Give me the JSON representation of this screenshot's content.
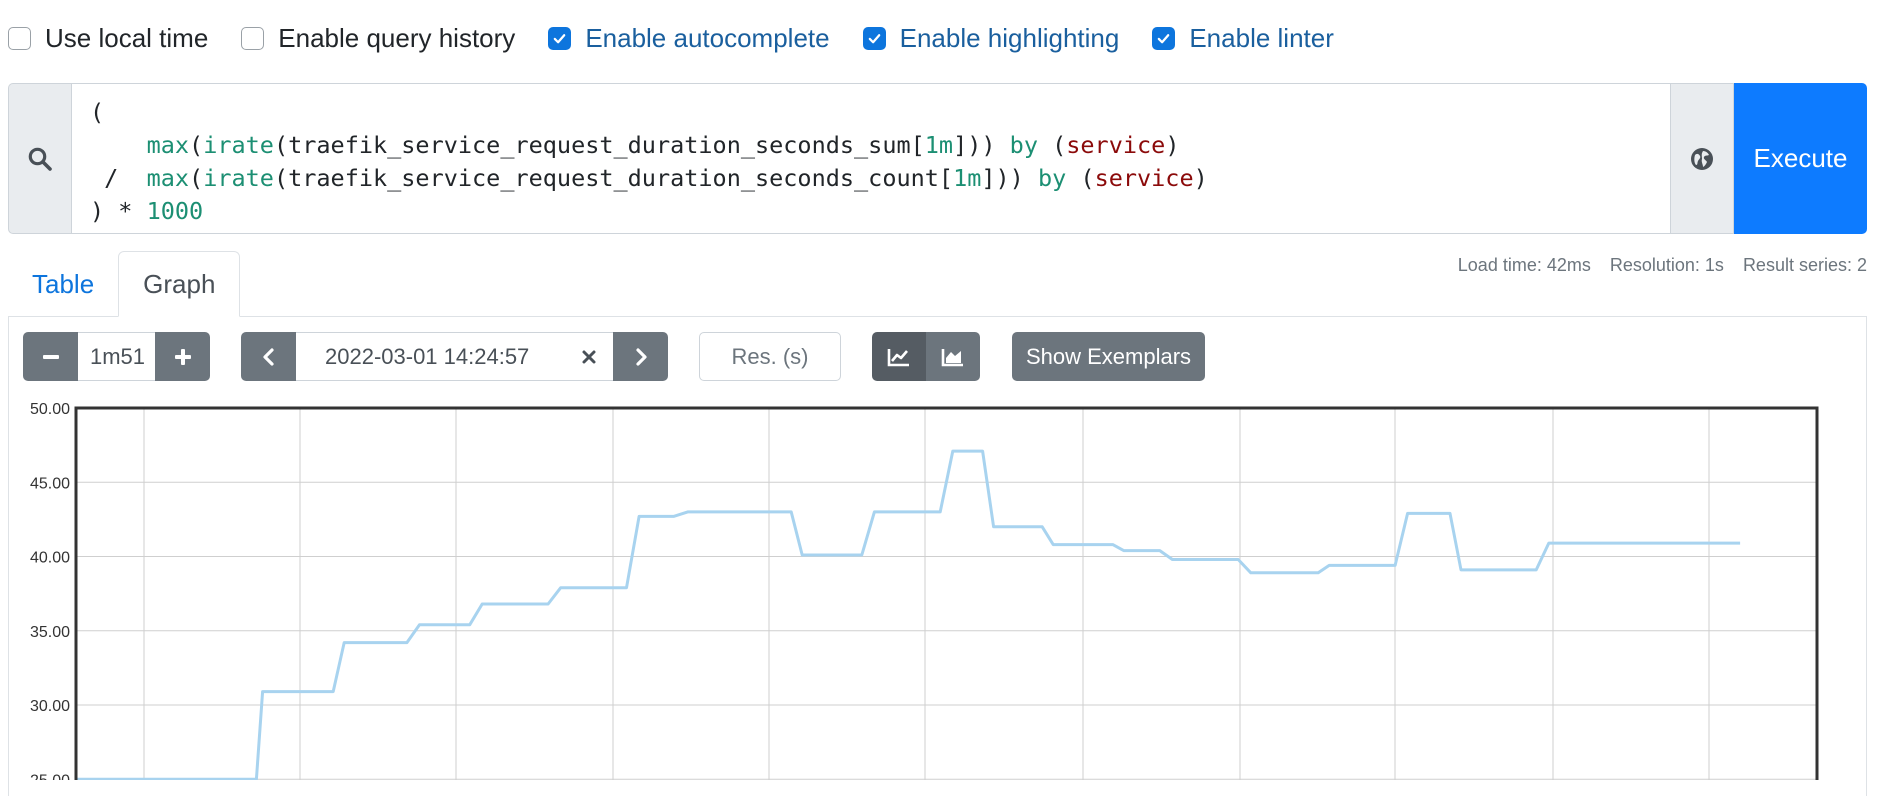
{
  "options": [
    {
      "label": "Use local time",
      "checked": false
    },
    {
      "label": "Enable query history",
      "checked": false
    },
    {
      "label": "Enable autocomplete",
      "checked": true
    },
    {
      "label": "Enable highlighting",
      "checked": true
    },
    {
      "label": "Enable linter",
      "checked": true
    }
  ],
  "query": {
    "line1": "(",
    "line2_indent": "    ",
    "line2_fn1": "max",
    "line2_p1": "(",
    "line2_fn2": "irate",
    "line2_p2": "(traefik_service_request_duration_seconds_sum[",
    "line2_dur": "1m",
    "line2_p3": "])) ",
    "line2_by": "by",
    "line2_p4": " (",
    "line2_lbl": "service",
    "line2_p5": ")",
    "line3_pre": " /  ",
    "line3_fn1": "max",
    "line3_p1": "(",
    "line3_fn2": "irate",
    "line3_p2": "(traefik_service_request_duration_seconds_count[",
    "line3_dur": "1m",
    "line3_p3": "])) ",
    "line3_by": "by",
    "line3_p4": " (",
    "line3_lbl": "service",
    "line3_p5": ")",
    "line4_pre": ") * ",
    "line4_num": "1000"
  },
  "execute_label": "Execute",
  "tabs": [
    {
      "label": "Table",
      "active": false
    },
    {
      "label": "Graph",
      "active": true
    }
  ],
  "stats": {
    "load_time": "Load time: 42ms",
    "resolution": "Resolution: 1s",
    "result_series": "Result series: 2"
  },
  "controls": {
    "range": "1m51",
    "end_time": "2022-03-01 14:24:57",
    "res_placeholder": "Res. (s)",
    "exemplars_label": "Show Exemplars"
  },
  "colors": {
    "accent": "#0d7bff",
    "series": "#a8d3ef",
    "grid": "#cfcfcf"
  },
  "chart_data": {
    "type": "line",
    "y_tick_labels": [
      "50.00",
      "45.00",
      "40.00",
      "35.00",
      "30.00",
      "25.00"
    ],
    "ylim": [
      25,
      50
    ],
    "xlim": [
      0,
      111
    ],
    "grid": true,
    "series": [
      {
        "x": [
          0,
          11.5,
          11.9,
          16.4,
          17.1,
          21.1,
          21.9,
          25.1,
          25.9,
          30.1,
          30.9,
          35.1,
          35.9,
          38.1,
          39.0,
          45.6,
          46.3,
          50.1,
          50.9,
          55.1,
          55.9,
          57.8,
          58.5,
          61.6,
          62.3,
          66.1,
          66.8,
          69.1,
          69.9,
          74.1,
          74.9,
          79.2,
          79.9,
          84.1,
          84.9,
          87.6,
          88.3,
          93.1,
          93.9,
          96.1,
          96.9,
          101.1,
          101.9,
          106.1
        ],
        "y": [
          25.0,
          25.0,
          30.9,
          30.9,
          34.2,
          34.2,
          35.4,
          35.4,
          36.8,
          36.8,
          37.9,
          37.9,
          42.7,
          42.7,
          43.0,
          43.0,
          40.1,
          40.1,
          43.0,
          43.0,
          47.1,
          47.1,
          42.0,
          42.0,
          40.8,
          40.8,
          40.4,
          40.4,
          39.8,
          39.8,
          38.9,
          38.9,
          39.4,
          39.4,
          42.9,
          42.9,
          39.1,
          39.1,
          40.9,
          40.9,
          40.9,
          40.9,
          40.9,
          40.9
        ]
      }
    ]
  }
}
